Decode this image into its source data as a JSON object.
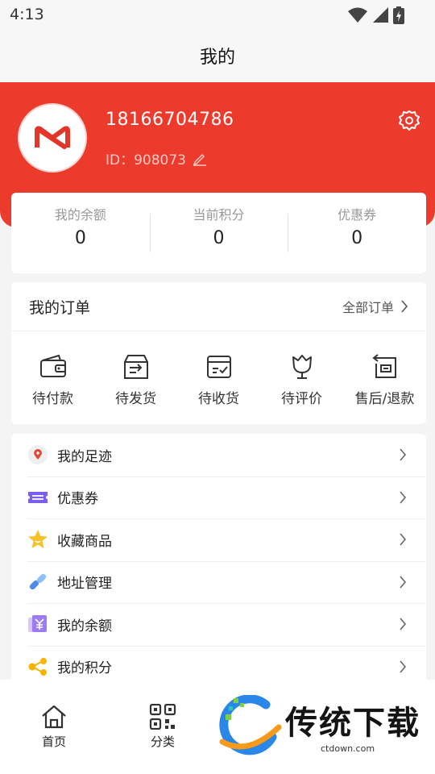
{
  "status_bar": {
    "time": "4:13"
  },
  "header": {
    "title": "我的"
  },
  "profile": {
    "phone": "18166704786",
    "id_label": "ID：908073"
  },
  "stats": [
    {
      "label": "我的余额",
      "value": "0"
    },
    {
      "label": "当前积分",
      "value": "0"
    },
    {
      "label": "优惠券",
      "value": "0"
    }
  ],
  "orders": {
    "title": "我的订单",
    "all_label": "全部订单",
    "items": [
      {
        "label": "待付款",
        "icon": "wallet-icon"
      },
      {
        "label": "待发货",
        "icon": "box-send-icon"
      },
      {
        "label": "待收货",
        "icon": "box-check-icon"
      },
      {
        "label": "待评价",
        "icon": "flower-icon"
      },
      {
        "label": "售后/退款",
        "icon": "refund-icon"
      }
    ]
  },
  "menu": [
    {
      "label": "我的足迹",
      "icon": "location-pin-icon"
    },
    {
      "label": "优惠券",
      "icon": "coupon-icon"
    },
    {
      "label": "收藏商品",
      "icon": "star-icon"
    },
    {
      "label": "地址管理",
      "icon": "link-icon"
    },
    {
      "label": "我的余额",
      "icon": "yuan-icon"
    },
    {
      "label": "我的积分",
      "icon": "share-icon"
    }
  ],
  "tab_bar": [
    {
      "label": "首页",
      "icon": "home-icon"
    },
    {
      "label": "分类",
      "icon": "qr-icon"
    }
  ],
  "watermark": {
    "text": "传统下载",
    "url": "ctdown.com"
  },
  "colors": {
    "brand_red": "#ec3a2c",
    "background": "#f4f4f4"
  }
}
